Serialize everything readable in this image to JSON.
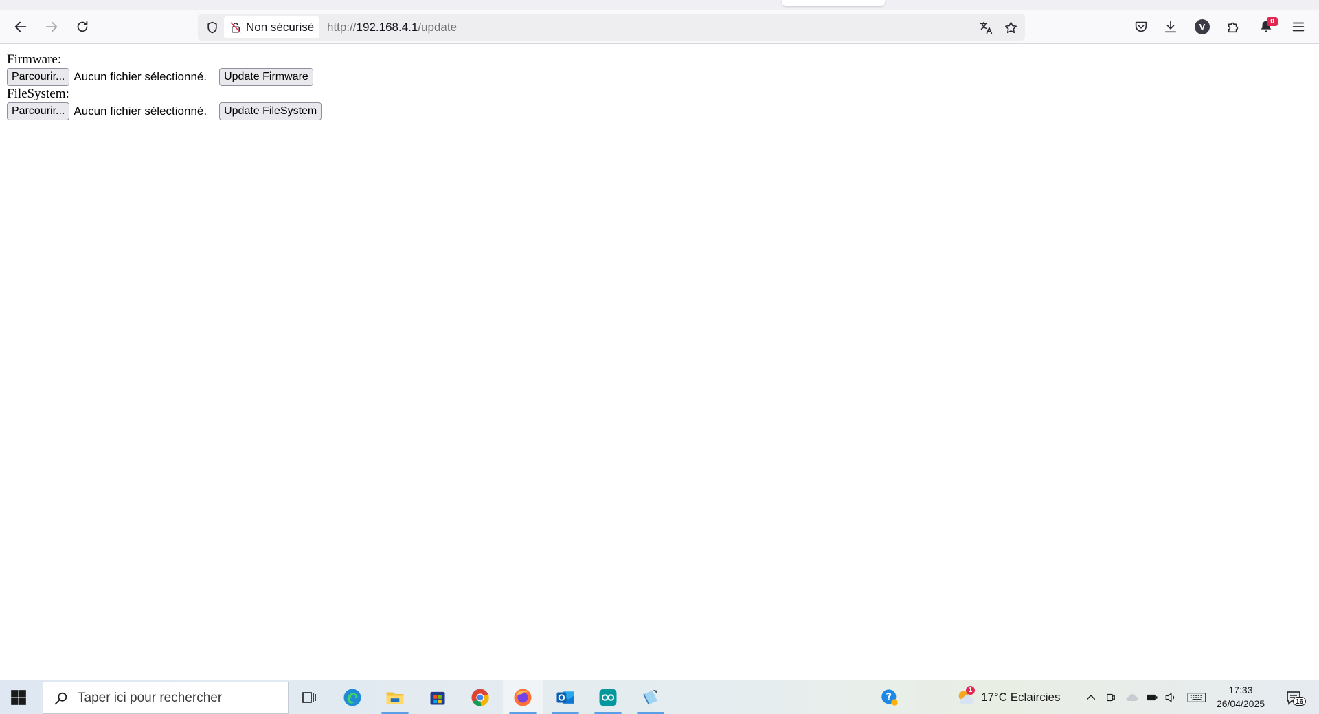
{
  "browser": {
    "security_label": "Non sécurisé",
    "url_scheme": "http://",
    "url_host": "192.168.4.1",
    "url_path": "/update",
    "profile_initial": "V",
    "notification_count": "0"
  },
  "page": {
    "firmware_label": "Firmware:",
    "filesystem_label": "FileSystem:",
    "browse_label": "Parcourir...",
    "no_file_text": "Aucun fichier sélectionné.",
    "update_firmware_label": "Update Firmware",
    "update_filesystem_label": "Update FileSystem"
  },
  "taskbar": {
    "search_placeholder": "Taper ici pour rechercher",
    "weather_badge": "1",
    "weather_text": "17°C  Eclaircies",
    "time": "17:33",
    "date": "26/04/2025",
    "notification_count": "16",
    "apps": [
      "task-view",
      "edge",
      "file-explorer",
      "microsoft-store",
      "chrome",
      "firefox",
      "outlook",
      "arduino",
      "notepad"
    ]
  },
  "colors": {
    "accent": "#5aa0e6",
    "badge_red": "#e22850",
    "button_bg": "#e9e9ed"
  }
}
